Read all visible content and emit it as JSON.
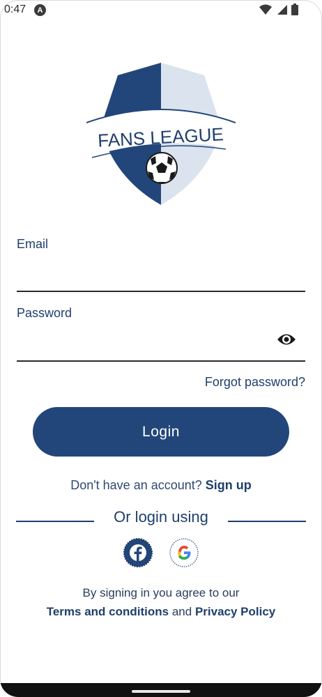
{
  "status_bar": {
    "time": "0:47",
    "badge": "A",
    "icons": [
      "wifi-icon",
      "signal-icon",
      "battery-icon"
    ]
  },
  "logo": {
    "text": "FANS LEAGUE",
    "icon": "soccer-ball-icon"
  },
  "form": {
    "email_label": "Email",
    "email_value": "",
    "password_label": "Password",
    "password_value": "",
    "password_toggle_icon": "eye-icon",
    "forgot_password": "Forgot password?",
    "login_button": "Login"
  },
  "signup": {
    "prompt": "Don't have an account?",
    "link": "Sign up"
  },
  "social": {
    "divider_text": "Or login using",
    "providers": [
      "facebook-icon",
      "google-icon"
    ]
  },
  "terms": {
    "line1": "By signing in you agree to our",
    "terms_link": "Terms and conditions",
    "and": "and",
    "privacy_link": "Privacy Policy"
  },
  "colors": {
    "primary": "#22467a",
    "text": "#1f3f6c",
    "shield_light": "#dbe3ef"
  }
}
